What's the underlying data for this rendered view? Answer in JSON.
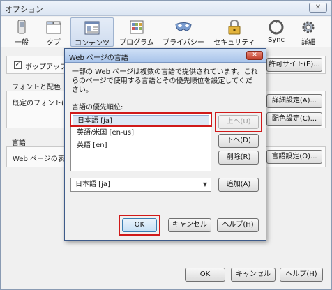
{
  "window": {
    "title": "オプション",
    "close": "✕"
  },
  "toolbar": [
    {
      "id": "general",
      "label": "一般",
      "icon": "switch-icon"
    },
    {
      "id": "tabs",
      "label": "タブ",
      "icon": "tabs-icon"
    },
    {
      "id": "content",
      "label": "コンテンツ",
      "icon": "content-icon",
      "selected": true
    },
    {
      "id": "programs",
      "label": "プログラム",
      "icon": "programs-icon"
    },
    {
      "id": "privacy",
      "label": "プライバシー",
      "icon": "privacy-mask-icon"
    },
    {
      "id": "security",
      "label": "セキュリティ",
      "icon": "padlock-icon"
    },
    {
      "id": "sync",
      "label": "Sync",
      "icon": "sync-icon"
    },
    {
      "id": "advanced",
      "label": "詳細",
      "icon": "gear-icon"
    }
  ],
  "content": {
    "popup_label": "ポップアップ",
    "popup_checked": true,
    "allowed_sites_btn": "許可サイト(E)...",
    "fonts_section": "フォントと配色",
    "default_font_label": "既定のフォント(",
    "advanced_btn": "詳細設定(A)...",
    "colors_btn": "配色設定(C)...",
    "lang_section": "言語",
    "lang_row_label": "Web ページの表",
    "lang_btn": "言語設定(O)..."
  },
  "dialog": {
    "title": "Web ページの言語",
    "close": "✕",
    "description": "一部の Web ページは複数の言語で提供されています。これらのページで使用する言語とその優先順位を設定してください。",
    "list_label": "言語の優先順位:",
    "languages": [
      "日本語 [ja]",
      "英語/米国 [en-us]",
      "英語 [en]"
    ],
    "selected_index": 0,
    "up_btn": "上へ(U)",
    "down_btn": "下へ(D)",
    "remove_btn": "削除(R)",
    "add_select_value": "日本語 [ja]",
    "add_btn": "追加(A)",
    "ok": "OK",
    "cancel": "キャンセル",
    "help": "ヘルプ(H)"
  },
  "footer": {
    "ok": "OK",
    "cancel": "キャンセル",
    "help": "ヘルプ(H)"
  },
  "colors": {
    "highlight_box": "#d01a1a",
    "selection": "#dde8f5"
  }
}
